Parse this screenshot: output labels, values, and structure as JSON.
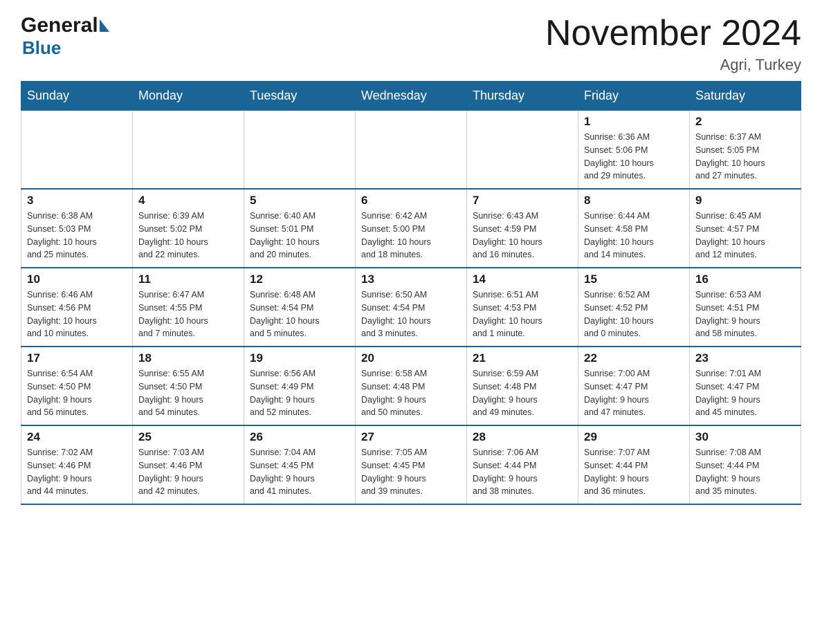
{
  "logo": {
    "general": "General",
    "blue": "Blue"
  },
  "title": "November 2024",
  "location": "Agri, Turkey",
  "days_of_week": [
    "Sunday",
    "Monday",
    "Tuesday",
    "Wednesday",
    "Thursday",
    "Friday",
    "Saturday"
  ],
  "weeks": [
    [
      {
        "day": "",
        "info": ""
      },
      {
        "day": "",
        "info": ""
      },
      {
        "day": "",
        "info": ""
      },
      {
        "day": "",
        "info": ""
      },
      {
        "day": "",
        "info": ""
      },
      {
        "day": "1",
        "info": "Sunrise: 6:36 AM\nSunset: 5:06 PM\nDaylight: 10 hours\nand 29 minutes."
      },
      {
        "day": "2",
        "info": "Sunrise: 6:37 AM\nSunset: 5:05 PM\nDaylight: 10 hours\nand 27 minutes."
      }
    ],
    [
      {
        "day": "3",
        "info": "Sunrise: 6:38 AM\nSunset: 5:03 PM\nDaylight: 10 hours\nand 25 minutes."
      },
      {
        "day": "4",
        "info": "Sunrise: 6:39 AM\nSunset: 5:02 PM\nDaylight: 10 hours\nand 22 minutes."
      },
      {
        "day": "5",
        "info": "Sunrise: 6:40 AM\nSunset: 5:01 PM\nDaylight: 10 hours\nand 20 minutes."
      },
      {
        "day": "6",
        "info": "Sunrise: 6:42 AM\nSunset: 5:00 PM\nDaylight: 10 hours\nand 18 minutes."
      },
      {
        "day": "7",
        "info": "Sunrise: 6:43 AM\nSunset: 4:59 PM\nDaylight: 10 hours\nand 16 minutes."
      },
      {
        "day": "8",
        "info": "Sunrise: 6:44 AM\nSunset: 4:58 PM\nDaylight: 10 hours\nand 14 minutes."
      },
      {
        "day": "9",
        "info": "Sunrise: 6:45 AM\nSunset: 4:57 PM\nDaylight: 10 hours\nand 12 minutes."
      }
    ],
    [
      {
        "day": "10",
        "info": "Sunrise: 6:46 AM\nSunset: 4:56 PM\nDaylight: 10 hours\nand 10 minutes."
      },
      {
        "day": "11",
        "info": "Sunrise: 6:47 AM\nSunset: 4:55 PM\nDaylight: 10 hours\nand 7 minutes."
      },
      {
        "day": "12",
        "info": "Sunrise: 6:48 AM\nSunset: 4:54 PM\nDaylight: 10 hours\nand 5 minutes."
      },
      {
        "day": "13",
        "info": "Sunrise: 6:50 AM\nSunset: 4:54 PM\nDaylight: 10 hours\nand 3 minutes."
      },
      {
        "day": "14",
        "info": "Sunrise: 6:51 AM\nSunset: 4:53 PM\nDaylight: 10 hours\nand 1 minute."
      },
      {
        "day": "15",
        "info": "Sunrise: 6:52 AM\nSunset: 4:52 PM\nDaylight: 10 hours\nand 0 minutes."
      },
      {
        "day": "16",
        "info": "Sunrise: 6:53 AM\nSunset: 4:51 PM\nDaylight: 9 hours\nand 58 minutes."
      }
    ],
    [
      {
        "day": "17",
        "info": "Sunrise: 6:54 AM\nSunset: 4:50 PM\nDaylight: 9 hours\nand 56 minutes."
      },
      {
        "day": "18",
        "info": "Sunrise: 6:55 AM\nSunset: 4:50 PM\nDaylight: 9 hours\nand 54 minutes."
      },
      {
        "day": "19",
        "info": "Sunrise: 6:56 AM\nSunset: 4:49 PM\nDaylight: 9 hours\nand 52 minutes."
      },
      {
        "day": "20",
        "info": "Sunrise: 6:58 AM\nSunset: 4:48 PM\nDaylight: 9 hours\nand 50 minutes."
      },
      {
        "day": "21",
        "info": "Sunrise: 6:59 AM\nSunset: 4:48 PM\nDaylight: 9 hours\nand 49 minutes."
      },
      {
        "day": "22",
        "info": "Sunrise: 7:00 AM\nSunset: 4:47 PM\nDaylight: 9 hours\nand 47 minutes."
      },
      {
        "day": "23",
        "info": "Sunrise: 7:01 AM\nSunset: 4:47 PM\nDaylight: 9 hours\nand 45 minutes."
      }
    ],
    [
      {
        "day": "24",
        "info": "Sunrise: 7:02 AM\nSunset: 4:46 PM\nDaylight: 9 hours\nand 44 minutes."
      },
      {
        "day": "25",
        "info": "Sunrise: 7:03 AM\nSunset: 4:46 PM\nDaylight: 9 hours\nand 42 minutes."
      },
      {
        "day": "26",
        "info": "Sunrise: 7:04 AM\nSunset: 4:45 PM\nDaylight: 9 hours\nand 41 minutes."
      },
      {
        "day": "27",
        "info": "Sunrise: 7:05 AM\nSunset: 4:45 PM\nDaylight: 9 hours\nand 39 minutes."
      },
      {
        "day": "28",
        "info": "Sunrise: 7:06 AM\nSunset: 4:44 PM\nDaylight: 9 hours\nand 38 minutes."
      },
      {
        "day": "29",
        "info": "Sunrise: 7:07 AM\nSunset: 4:44 PM\nDaylight: 9 hours\nand 36 minutes."
      },
      {
        "day": "30",
        "info": "Sunrise: 7:08 AM\nSunset: 4:44 PM\nDaylight: 9 hours\nand 35 minutes."
      }
    ]
  ]
}
